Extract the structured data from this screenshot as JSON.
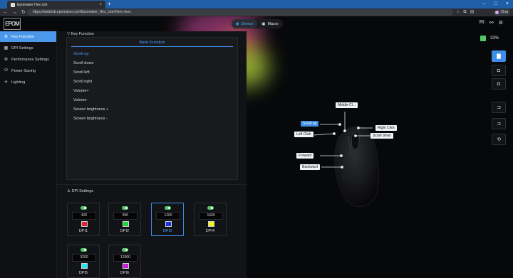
{
  "browser": {
    "tab_title": "Epomaker Hex Lite",
    "new_tab": "+",
    "url": "https://webhub.epomaker.com/Epomaker_Hex_Lite/#/key-func",
    "profile": "Chat"
  },
  "app": {
    "logo": "EPOM",
    "switch": {
      "device": "Device",
      "macro": "Macro"
    },
    "header_right": "RI",
    "battery": "33%"
  },
  "sidebar": {
    "items": [
      {
        "label": "Key Function",
        "icon": "gear-icon"
      },
      {
        "label": "DPI Settings",
        "icon": "dpi-icon"
      },
      {
        "label": "Performance Settings",
        "icon": "performance-icon"
      },
      {
        "label": "Power Saving",
        "icon": "power-icon"
      },
      {
        "label": "Lighting",
        "icon": "light-icon"
      }
    ]
  },
  "key_function": {
    "section_title": "Key Function",
    "panel_title": "Basic Function",
    "items": [
      "Scroll up",
      "Scroll down",
      "Scroll left",
      "Scroll right",
      "Volume+",
      "Volume-",
      "Screen brightness +",
      "Screen brightness -"
    ],
    "selected": "Scroll up"
  },
  "dpi": {
    "section_title": "DPI Settings",
    "levels": [
      {
        "value": "400",
        "name": "DPI1",
        "color": "#e5202a"
      },
      {
        "value": "800",
        "name": "DPI2",
        "color": "#1fd238"
      },
      {
        "value": "1200",
        "name": "DPI3",
        "color": "#1c2fe6"
      },
      {
        "value": "1600",
        "name": "DPI4",
        "color": "#f2f21a"
      },
      {
        "value": "3200",
        "name": "DPI5",
        "color": "#1ee6f0"
      },
      {
        "value": "12000",
        "name": "DPI6",
        "color": "#c21fd6"
      }
    ],
    "active": "DPI3"
  },
  "mouse_labels": {
    "middle": "Middle Cl...",
    "scroll_up": "Scroll up",
    "right_click": "Right Click",
    "left_click": "Left Click",
    "scroll_down": "Scroll down",
    "forward": "Forward",
    "backward": "Backward"
  },
  "colors": {
    "accent": "#3e8ee6",
    "toggle_on": "#55c96a",
    "battery": "#54c76a"
  }
}
